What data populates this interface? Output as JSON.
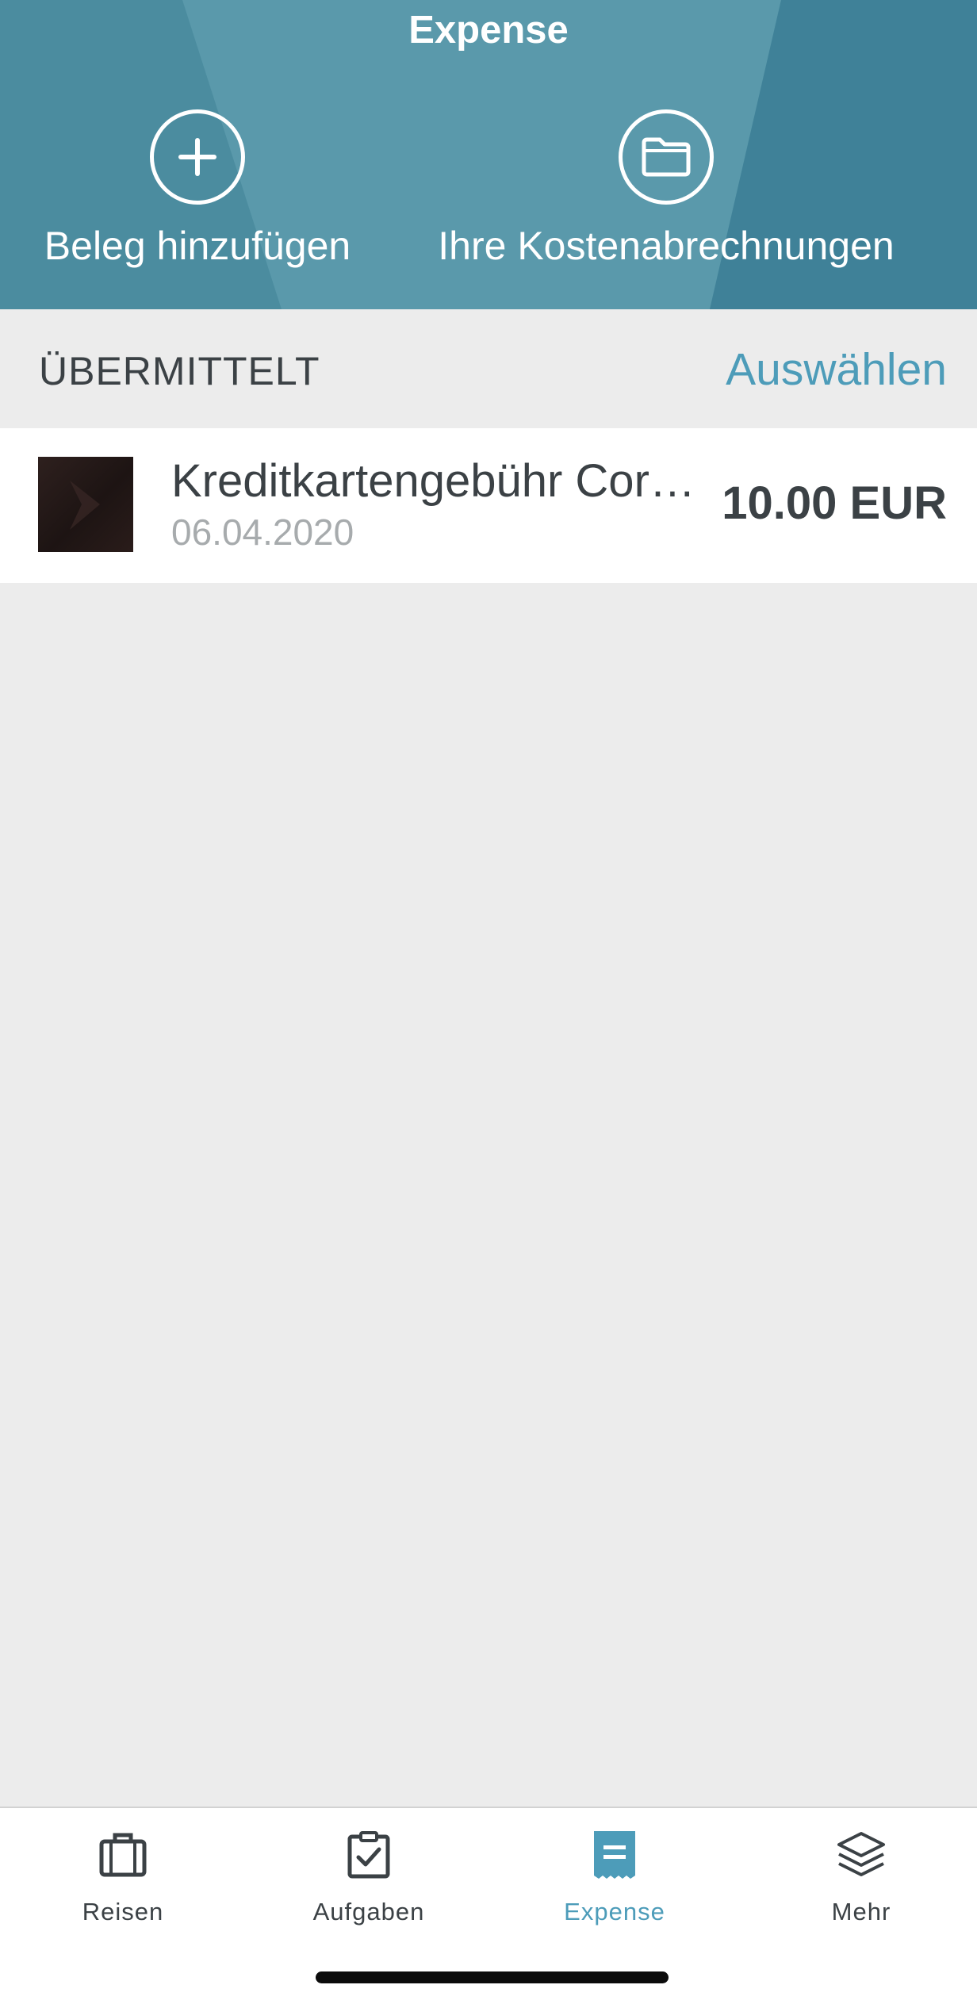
{
  "header": {
    "title": "Expense",
    "actions": [
      {
        "label": "Beleg hinzufügen",
        "icon": "plus-circle-icon"
      },
      {
        "label": "Ihre Kostenabrechnungen",
        "icon": "folder-circle-icon"
      }
    ]
  },
  "section": {
    "title": "ÜBERMITTELT",
    "select_label": "Auswählen"
  },
  "expenses": [
    {
      "title": "Kreditkartengebühr Cor…",
      "date": "06.04.2020",
      "amount": "10.00 EUR"
    }
  ],
  "tabbar": {
    "items": [
      {
        "label": "Reisen",
        "icon": "suitcase-icon",
        "active": false
      },
      {
        "label": "Aufgaben",
        "icon": "clipboard-check-icon",
        "active": false
      },
      {
        "label": "Expense",
        "icon": "receipt-icon",
        "active": true
      },
      {
        "label": "Mehr",
        "icon": "layers-icon",
        "active": false
      }
    ]
  },
  "colors": {
    "header_bg": "#4f90a2",
    "accent": "#4d9cb9",
    "text_dark": "#3b4145",
    "text_muted": "#a7abad",
    "background": "#ececec"
  }
}
